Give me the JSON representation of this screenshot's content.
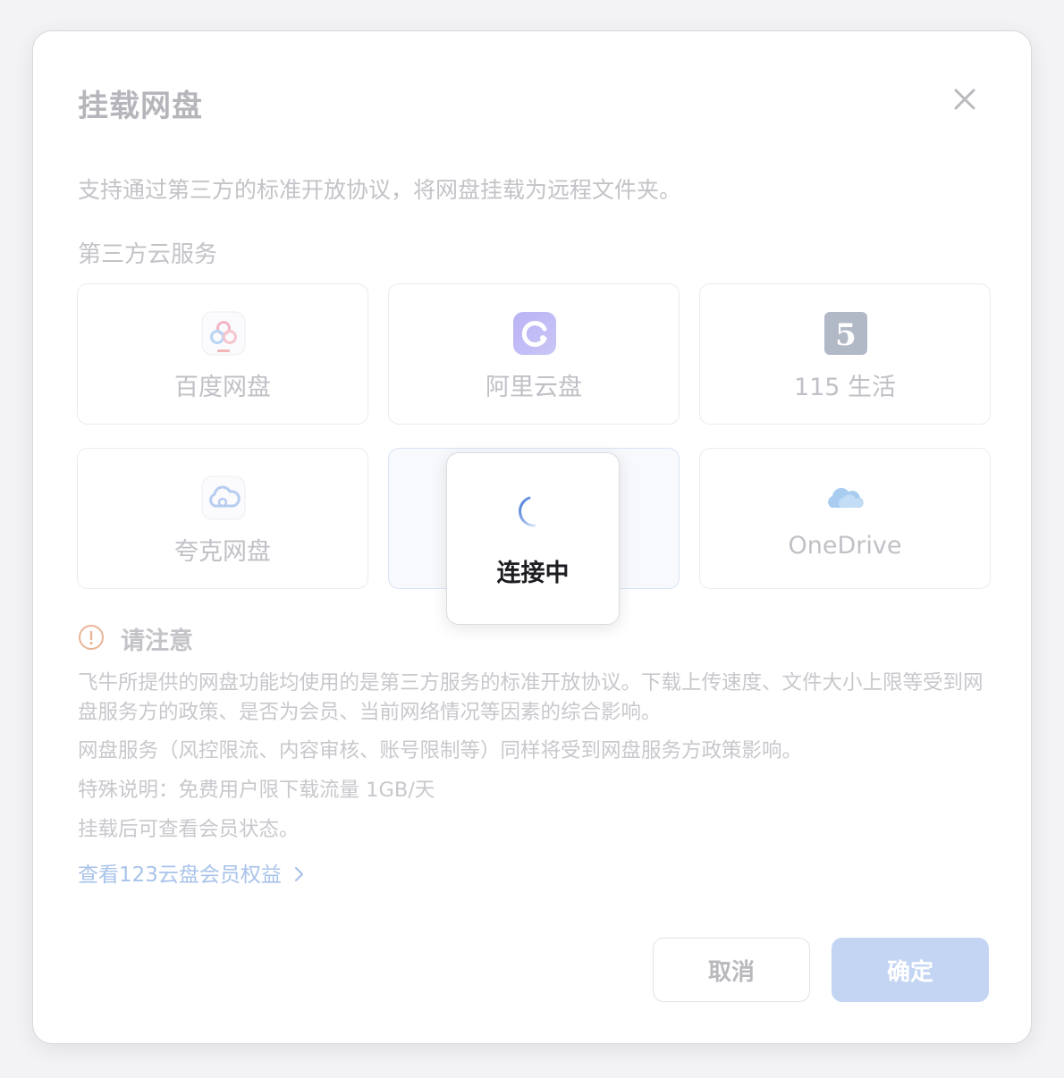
{
  "dialog": {
    "title": "挂载网盘",
    "description": "支持通过第三方的标准开放协议，将网盘挂载为远程文件夹。",
    "section_label": "第三方云服务"
  },
  "services": [
    {
      "label": "百度网盘",
      "icon": "baidu-netdisk-icon"
    },
    {
      "label": "阿里云盘",
      "icon": "aliyun-drive-icon"
    },
    {
      "label": "115 生活",
      "icon": "115-life-icon"
    },
    {
      "label": "夸克网盘",
      "icon": "quark-netdisk-icon"
    },
    {
      "label": "",
      "icon": "",
      "selected": true
    },
    {
      "label": "OneDrive",
      "icon": "onedrive-icon"
    }
  ],
  "notice": {
    "heading": "请注意",
    "paragraphs": [
      "飞牛所提供的网盘功能均使用的是第三方服务的标准开放协议。下载上传速度、文件大小上限等受到网盘服务方的政策、是否为会员、当前网络情况等因素的综合影响。",
      "网盘服务（风控限流、内容审核、账号限制等）同样将受到网盘服务方政策影响。",
      "特殊说明：免费用户限下载流量 1GB/天",
      "挂载后可查看会员状态。"
    ],
    "link": "查看123云盘会员权益"
  },
  "buttons": {
    "cancel": "取消",
    "confirm": "确定"
  },
  "loading": {
    "label": "连接中"
  },
  "colors": {
    "accent": "#4a7fd8",
    "confirm_disabled": "#c4d5f3",
    "warning": "#e8a27a"
  }
}
